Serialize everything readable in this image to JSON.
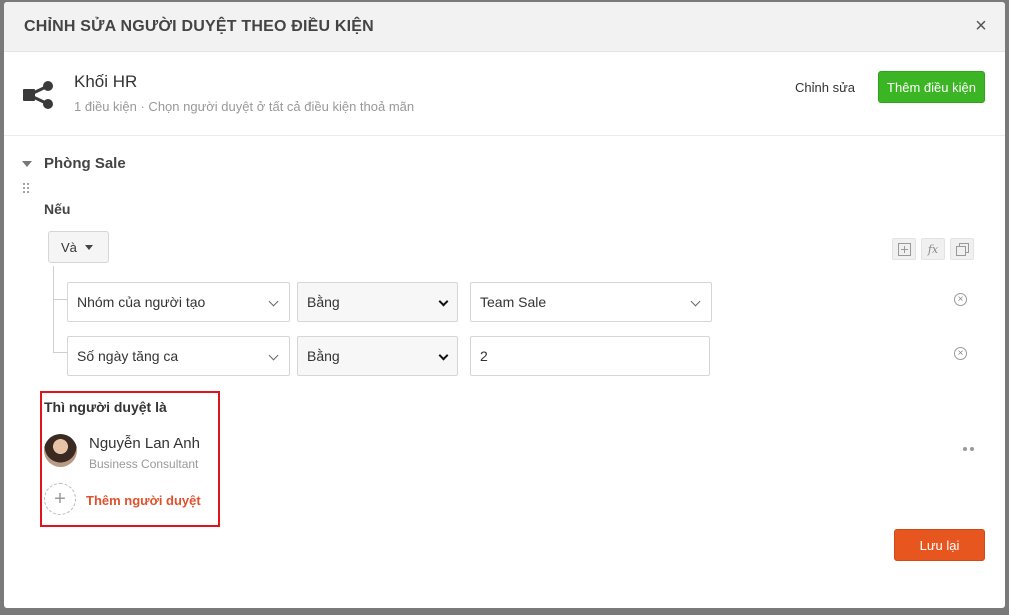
{
  "modal": {
    "title": "CHỈNH SỬA NGƯỜI DUYỆT THEO ĐIỀU KIỆN",
    "close_symbol": "×"
  },
  "group": {
    "icon": "share-network-icon",
    "title": "Khối HR",
    "subtitle": "1 điều kiện · Chọn người duyệt ở tất cả điều kiện thoả mãn",
    "edit_label": "Chỉnh sửa",
    "add_condition_label": "Thêm điều kiện"
  },
  "department": {
    "title": "Phòng Sale",
    "if_label": "Nếu",
    "operator": "Và",
    "tools": [
      "plus-square-icon",
      "function-icon",
      "copy-icon"
    ],
    "tools_fx": "fx",
    "conditions": [
      {
        "field": "Nhóm của người tạo",
        "operator": "Bằng",
        "value": "Team Sale"
      },
      {
        "field": "Số ngày tăng ca",
        "operator": "Bằng",
        "value": "2"
      }
    ]
  },
  "approvers": {
    "label": "Thì người duyệt là",
    "list": [
      {
        "name": "Nguyễn Lan Anh",
        "role": "Business Consultant"
      }
    ],
    "add_label": "Thêm người duyệt",
    "add_symbol": "+"
  },
  "footer": {
    "save_label": "Lưu lại"
  },
  "colors": {
    "primary_green": "#3bb524",
    "save_orange": "#e8561f",
    "highlight_red": "#e0141b",
    "link_orange": "#e0522c"
  }
}
